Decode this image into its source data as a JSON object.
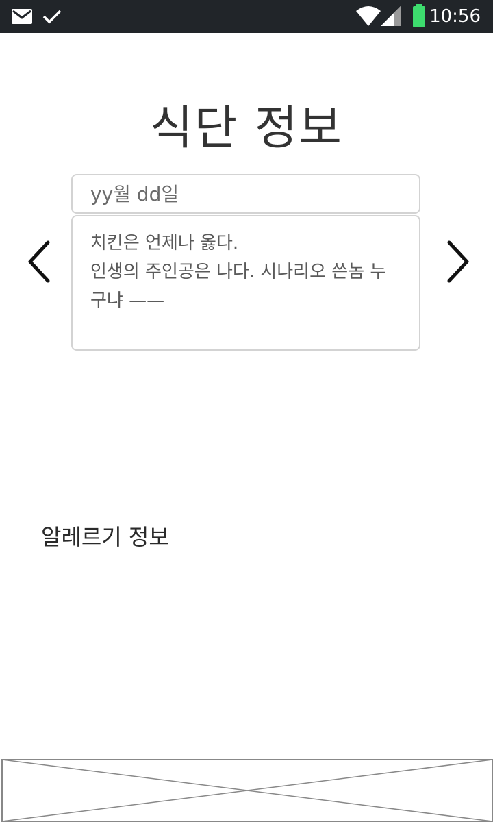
{
  "status_bar": {
    "time": "10:56",
    "icons": [
      "mail-icon",
      "check-icon",
      "wifi-icon",
      "signal-icon",
      "battery-icon"
    ],
    "battery_color": "#3ddc6e"
  },
  "main": {
    "title": "식단 정보",
    "date_placeholder": "yy월 dd일",
    "meal_lines": [
      "치킨은 언제나 옳다.",
      "인생의 주인공은 나다. 시나리오 쓴놈 누",
      "구냐 ——"
    ],
    "prev_icon": "chevron-left-icon",
    "next_icon": "chevron-right-icon",
    "allergy_label": "알레르기 정보"
  },
  "ad": {
    "icon": "image-placeholder-icon"
  }
}
